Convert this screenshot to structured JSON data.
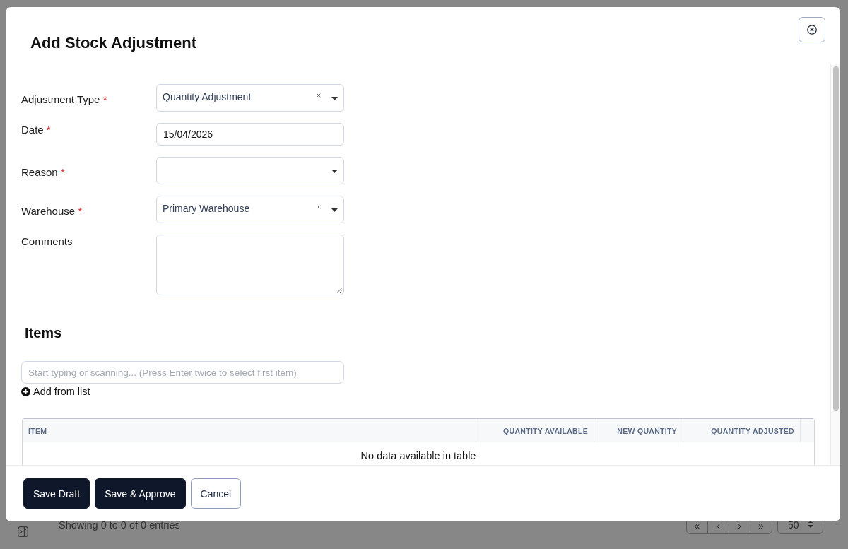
{
  "background_page": {
    "entries_info": "Showing 0 to 0 of 0 entries",
    "pagination": [
      "«",
      "‹",
      "›",
      "»"
    ],
    "page_size": "50"
  },
  "dialog": {
    "title": "Add Stock Adjustment",
    "fields": [
      {
        "label": "Adjustment Type",
        "required_mark": "*",
        "kind": "select",
        "value": "Quantity Adjustment",
        "clearable": true
      },
      {
        "label": "Date",
        "required_mark": "*",
        "kind": "date",
        "value": "15/04/2026",
        "clearable": false
      },
      {
        "label": "Reason",
        "required_mark": "*",
        "kind": "select",
        "clearable": false
      },
      {
        "label": "Warehouse",
        "required_mark": "*",
        "kind": "select",
        "value": "Primary Warehouse",
        "clearable": true
      },
      {
        "label": "Comments",
        "kind": "textarea",
        "clearable": false
      }
    ],
    "items": {
      "heading": "Items",
      "search": {
        "placeholder": "Start typing or scanning... (Press Enter twice to select first item)"
      },
      "add_from_list": "Add from list",
      "table": {
        "columns": [
          "ITEM",
          "QUANTITY AVAILABLE",
          "NEW QUANTITY",
          "QUANTITY ADJUSTED"
        ],
        "empty_message": "No data available in table"
      }
    },
    "buttons": [
      {
        "label": "Save Draft",
        "kind": "primary"
      },
      {
        "label": "Save & Approve",
        "kind": "primary"
      },
      {
        "label": "Cancel",
        "kind": "secondary"
      }
    ]
  }
}
